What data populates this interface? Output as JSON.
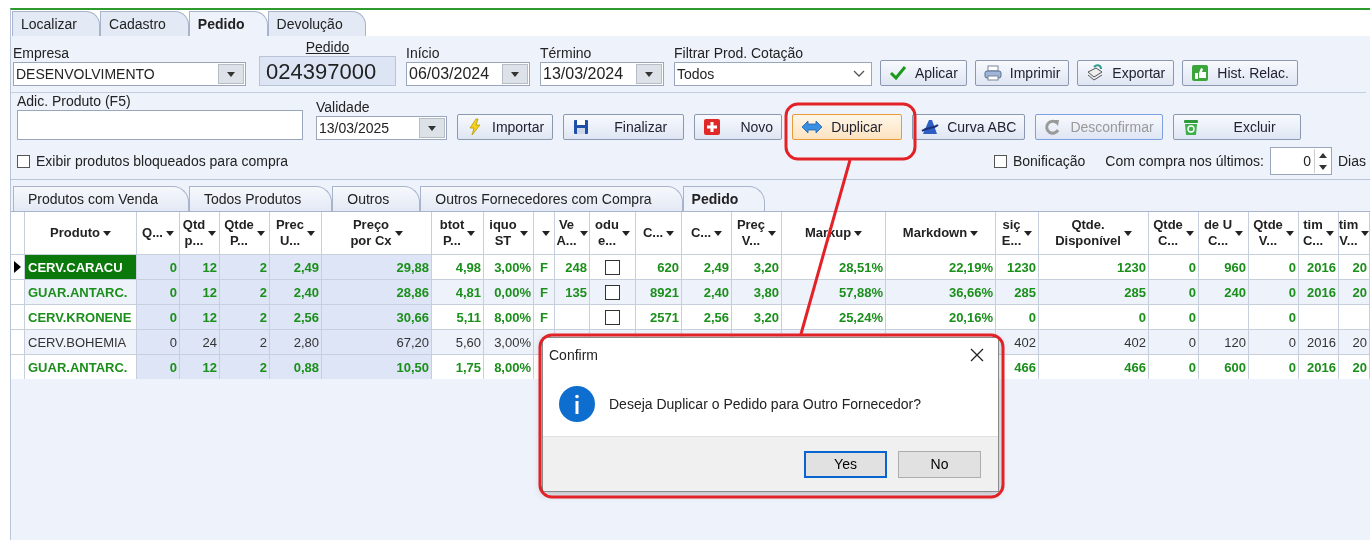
{
  "main_tabs": [
    {
      "label": "Localizar",
      "selected": false
    },
    {
      "label": "Cadastro",
      "selected": false
    },
    {
      "label": "Pedido",
      "selected": true
    },
    {
      "label": "Devolução",
      "selected": false
    }
  ],
  "header_form": {
    "empresa": {
      "label": "Empresa",
      "value": "DESENVOLVIMENTO"
    },
    "pedido": {
      "label": "Pedido",
      "value": "024397000"
    },
    "inicio": {
      "label": "Início",
      "value": "06/03/2024"
    },
    "termino": {
      "label": "Término",
      "value": "13/03/2024"
    },
    "filtro": {
      "label": "Filtrar Prod. Cotação",
      "value": "Todos"
    }
  },
  "top_buttons": [
    {
      "label": "Aplicar",
      "kind": "check"
    },
    {
      "label": "Imprimir",
      "kind": "printer"
    },
    {
      "label": "Exportar",
      "kind": "export"
    },
    {
      "label": "Hist. Relac.",
      "kind": "history"
    }
  ],
  "produto_field": {
    "label": "Adic. Produto (F5)"
  },
  "validade": {
    "label": "Validade",
    "value": "13/03/2025"
  },
  "action_buttons": [
    {
      "label": "Importar",
      "kind": "lightning",
      "disabled": false,
      "highlighted": false
    },
    {
      "label": "Finalizar",
      "kind": "floppy",
      "disabled": false,
      "highlighted": false
    },
    {
      "label": "Novo",
      "kind": "plus",
      "disabled": false,
      "highlighted": false
    },
    {
      "label": "Duplicar",
      "kind": "arrows",
      "disabled": false,
      "highlighted": true
    },
    {
      "label": "Curva ABC",
      "kind": "curve",
      "disabled": false,
      "highlighted": false
    },
    {
      "label": "Desconfirmar",
      "kind": "undo",
      "disabled": true,
      "highlighted": false
    },
    {
      "label": "Excluir",
      "kind": "bin",
      "disabled": false,
      "highlighted": false
    }
  ],
  "options": {
    "bloqueados": {
      "label": "Exibir produtos bloqueados para compra",
      "checked": false
    },
    "bonificacao": {
      "label": "Bonificação",
      "checked": false
    },
    "dias": {
      "label": "Com compra nos últimos:",
      "value": "0",
      "unit": "Dias"
    }
  },
  "sub_tabs": [
    {
      "label": "Produtos com Venda",
      "selected": false
    },
    {
      "label": "Todos Produtos",
      "selected": false
    },
    {
      "label": "Outros",
      "selected": false
    },
    {
      "label": "Outros Fornecedores com Compra",
      "selected": false
    },
    {
      "label": "Pedido",
      "selected": true
    }
  ],
  "grid": {
    "columns": [
      {
        "lines": [
          "Produto"
        ],
        "kind": "text",
        "shaded": false
      },
      {
        "lines": [
          "Q..."
        ],
        "kind": "number",
        "shaded": true
      },
      {
        "lines": [
          "Qtd",
          "p..."
        ],
        "kind": "number",
        "shaded": true
      },
      {
        "lines": [
          "Qtde",
          "P..."
        ],
        "kind": "number",
        "shaded": true
      },
      {
        "lines": [
          "Prec",
          "U..."
        ],
        "kind": "number",
        "shaded": true
      },
      {
        "lines": [
          "Preço",
          "por Cx"
        ],
        "kind": "number",
        "shaded": true
      },
      {
        "lines": [
          "btot",
          "P..."
        ],
        "kind": "number",
        "shaded": false
      },
      {
        "lines": [
          "iquo",
          "ST"
        ],
        "kind": "number",
        "shaded": false
      },
      {
        "kind": "flag",
        "shaded": false
      },
      {
        "lines": [
          "Ve",
          "A..."
        ],
        "kind": "number",
        "shaded": false
      },
      {
        "lines": [
          "odu",
          "e..."
        ],
        "kind": "check",
        "shaded": false
      },
      {
        "lines": [
          "C..."
        ],
        "kind": "number",
        "shaded": false
      },
      {
        "lines": [
          "C..."
        ],
        "kind": "number",
        "shaded": false
      },
      {
        "lines": [
          "Preç",
          "V..."
        ],
        "kind": "number",
        "shaded": false
      },
      {
        "lines": [
          "Markup"
        ],
        "kind": "number",
        "shaded": false
      },
      {
        "lines": [
          "Markdown"
        ],
        "kind": "number",
        "shaded": false
      },
      {
        "lines": [
          "siç",
          "E..."
        ],
        "kind": "number",
        "shaded": false
      },
      {
        "lines": [
          "Qtde.",
          "Disponível"
        ],
        "kind": "number",
        "shaded": false
      },
      {
        "lines": [
          "Qtde",
          "C..."
        ],
        "kind": "number",
        "shaded": false
      },
      {
        "lines": [
          "de U",
          "C..."
        ],
        "kind": "number",
        "shaded": false
      },
      {
        "lines": [
          "Qtde",
          "V..."
        ],
        "kind": "number",
        "shaded": false
      },
      {
        "lines": [
          "tim",
          "C..."
        ],
        "kind": "number",
        "shaded": false
      },
      {
        "lines": [
          "tim",
          "V..."
        ],
        "kind": "number",
        "shaded": false
      }
    ],
    "rows": [
      {
        "selected": true,
        "color": "#1a8f1a",
        "bold": true,
        "checked": false,
        "cells": [
          "CERV.CARACU",
          "0",
          "12",
          "2",
          "2,49",
          "29,88",
          "4,98",
          "3,00%",
          "F",
          "248",
          null,
          "620",
          "2,49",
          "3,20",
          "28,51%",
          "22,19%",
          "1230",
          "1230",
          "0",
          "960",
          "0",
          "2016",
          "20"
        ]
      },
      {
        "selected": false,
        "color": "#1a8f1a",
        "bold": true,
        "checked": false,
        "cells": [
          "GUAR.ANTARC.",
          "0",
          "12",
          "2",
          "2,40",
          "28,86",
          "4,81",
          "0,00%",
          "F",
          "135",
          null,
          "8921",
          "2,40",
          "3,80",
          "57,88%",
          "36,66%",
          "285",
          "285",
          "0",
          "240",
          "0",
          "2016",
          "20"
        ]
      },
      {
        "selected": false,
        "color": "#1a8f1a",
        "bold": true,
        "checked": false,
        "cells": [
          "CERV.KRONENE",
          "0",
          "12",
          "2",
          "2,56",
          "30,66",
          "5,11",
          "8,00%",
          "F",
          null,
          null,
          "2571",
          "2,56",
          "3,20",
          "25,24%",
          "20,16%",
          "0",
          "0",
          "0",
          null,
          "0",
          null,
          null
        ]
      },
      {
        "selected": false,
        "color": "#333333",
        "bold": false,
        "cells": [
          "CERV.BOHEMIA",
          "0",
          "24",
          "2",
          "2,80",
          "67,20",
          "5,60",
          "3,00%",
          null,
          null,
          null,
          null,
          null,
          null,
          null,
          null,
          "402",
          "402",
          "0",
          "120",
          "0",
          "2016",
          "20"
        ]
      },
      {
        "selected": false,
        "color": "#1a8f1a",
        "bold": true,
        "cells": [
          "GUAR.ANTARC.",
          "0",
          "12",
          "2",
          "0,88",
          "10,50",
          "1,75",
          "8,00%",
          null,
          null,
          null,
          null,
          null,
          null,
          null,
          null,
          "466",
          "466",
          "0",
          "600",
          "0",
          "2016",
          "20"
        ]
      }
    ]
  },
  "dialog": {
    "title": "Confirm",
    "message": "Deseja Duplicar o Pedido para Outro Fornecedor?",
    "buttons": [
      {
        "label": "Yes",
        "selected": true
      },
      {
        "label": "No",
        "selected": false
      }
    ]
  }
}
